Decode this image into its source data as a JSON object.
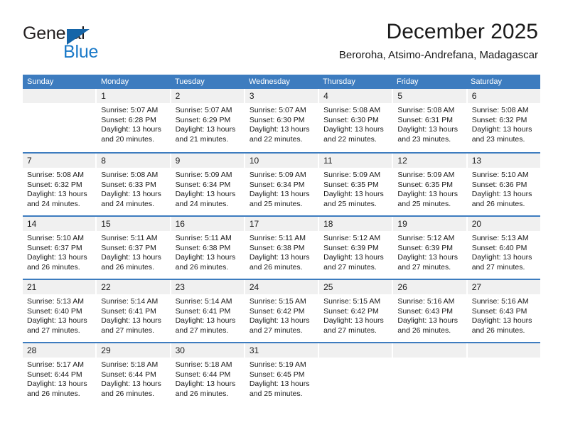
{
  "brand": {
    "word1": "General",
    "word2": "Blue",
    "triangle_color": "#1565a8",
    "blue_color": "#1a79c8"
  },
  "header": {
    "title": "December 2025",
    "subtitle": "Beroroha, Atsimo-Andrefana, Madagascar"
  },
  "theme": {
    "header_row_bg": "#3d7cbf",
    "daynum_bg": "#f0f0f0",
    "text_color": "#1a1a1a"
  },
  "weekdays": [
    "Sunday",
    "Monday",
    "Tuesday",
    "Wednesday",
    "Thursday",
    "Friday",
    "Saturday"
  ],
  "labels": {
    "sunrise_prefix": "Sunrise: ",
    "sunset_prefix": "Sunset: ",
    "daylight_prefix": "Daylight: "
  },
  "weeks": [
    [
      {
        "day": ""
      },
      {
        "day": "1",
        "sunrise": "Sunrise: 5:07 AM",
        "sunset": "Sunset: 6:28 PM",
        "daylight1": "Daylight: 13 hours",
        "daylight2": "and 20 minutes."
      },
      {
        "day": "2",
        "sunrise": "Sunrise: 5:07 AM",
        "sunset": "Sunset: 6:29 PM",
        "daylight1": "Daylight: 13 hours",
        "daylight2": "and 21 minutes."
      },
      {
        "day": "3",
        "sunrise": "Sunrise: 5:07 AM",
        "sunset": "Sunset: 6:30 PM",
        "daylight1": "Daylight: 13 hours",
        "daylight2": "and 22 minutes."
      },
      {
        "day": "4",
        "sunrise": "Sunrise: 5:08 AM",
        "sunset": "Sunset: 6:30 PM",
        "daylight1": "Daylight: 13 hours",
        "daylight2": "and 22 minutes."
      },
      {
        "day": "5",
        "sunrise": "Sunrise: 5:08 AM",
        "sunset": "Sunset: 6:31 PM",
        "daylight1": "Daylight: 13 hours",
        "daylight2": "and 23 minutes."
      },
      {
        "day": "6",
        "sunrise": "Sunrise: 5:08 AM",
        "sunset": "Sunset: 6:32 PM",
        "daylight1": "Daylight: 13 hours",
        "daylight2": "and 23 minutes."
      }
    ],
    [
      {
        "day": "7",
        "sunrise": "Sunrise: 5:08 AM",
        "sunset": "Sunset: 6:32 PM",
        "daylight1": "Daylight: 13 hours",
        "daylight2": "and 24 minutes."
      },
      {
        "day": "8",
        "sunrise": "Sunrise: 5:08 AM",
        "sunset": "Sunset: 6:33 PM",
        "daylight1": "Daylight: 13 hours",
        "daylight2": "and 24 minutes."
      },
      {
        "day": "9",
        "sunrise": "Sunrise: 5:09 AM",
        "sunset": "Sunset: 6:34 PM",
        "daylight1": "Daylight: 13 hours",
        "daylight2": "and 24 minutes."
      },
      {
        "day": "10",
        "sunrise": "Sunrise: 5:09 AM",
        "sunset": "Sunset: 6:34 PM",
        "daylight1": "Daylight: 13 hours",
        "daylight2": "and 25 minutes."
      },
      {
        "day": "11",
        "sunrise": "Sunrise: 5:09 AM",
        "sunset": "Sunset: 6:35 PM",
        "daylight1": "Daylight: 13 hours",
        "daylight2": "and 25 minutes."
      },
      {
        "day": "12",
        "sunrise": "Sunrise: 5:09 AM",
        "sunset": "Sunset: 6:35 PM",
        "daylight1": "Daylight: 13 hours",
        "daylight2": "and 25 minutes."
      },
      {
        "day": "13",
        "sunrise": "Sunrise: 5:10 AM",
        "sunset": "Sunset: 6:36 PM",
        "daylight1": "Daylight: 13 hours",
        "daylight2": "and 26 minutes."
      }
    ],
    [
      {
        "day": "14",
        "sunrise": "Sunrise: 5:10 AM",
        "sunset": "Sunset: 6:37 PM",
        "daylight1": "Daylight: 13 hours",
        "daylight2": "and 26 minutes."
      },
      {
        "day": "15",
        "sunrise": "Sunrise: 5:11 AM",
        "sunset": "Sunset: 6:37 PM",
        "daylight1": "Daylight: 13 hours",
        "daylight2": "and 26 minutes."
      },
      {
        "day": "16",
        "sunrise": "Sunrise: 5:11 AM",
        "sunset": "Sunset: 6:38 PM",
        "daylight1": "Daylight: 13 hours",
        "daylight2": "and 26 minutes."
      },
      {
        "day": "17",
        "sunrise": "Sunrise: 5:11 AM",
        "sunset": "Sunset: 6:38 PM",
        "daylight1": "Daylight: 13 hours",
        "daylight2": "and 26 minutes."
      },
      {
        "day": "18",
        "sunrise": "Sunrise: 5:12 AM",
        "sunset": "Sunset: 6:39 PM",
        "daylight1": "Daylight: 13 hours",
        "daylight2": "and 27 minutes."
      },
      {
        "day": "19",
        "sunrise": "Sunrise: 5:12 AM",
        "sunset": "Sunset: 6:39 PM",
        "daylight1": "Daylight: 13 hours",
        "daylight2": "and 27 minutes."
      },
      {
        "day": "20",
        "sunrise": "Sunrise: 5:13 AM",
        "sunset": "Sunset: 6:40 PM",
        "daylight1": "Daylight: 13 hours",
        "daylight2": "and 27 minutes."
      }
    ],
    [
      {
        "day": "21",
        "sunrise": "Sunrise: 5:13 AM",
        "sunset": "Sunset: 6:40 PM",
        "daylight1": "Daylight: 13 hours",
        "daylight2": "and 27 minutes."
      },
      {
        "day": "22",
        "sunrise": "Sunrise: 5:14 AM",
        "sunset": "Sunset: 6:41 PM",
        "daylight1": "Daylight: 13 hours",
        "daylight2": "and 27 minutes."
      },
      {
        "day": "23",
        "sunrise": "Sunrise: 5:14 AM",
        "sunset": "Sunset: 6:41 PM",
        "daylight1": "Daylight: 13 hours",
        "daylight2": "and 27 minutes."
      },
      {
        "day": "24",
        "sunrise": "Sunrise: 5:15 AM",
        "sunset": "Sunset: 6:42 PM",
        "daylight1": "Daylight: 13 hours",
        "daylight2": "and 27 minutes."
      },
      {
        "day": "25",
        "sunrise": "Sunrise: 5:15 AM",
        "sunset": "Sunset: 6:42 PM",
        "daylight1": "Daylight: 13 hours",
        "daylight2": "and 27 minutes."
      },
      {
        "day": "26",
        "sunrise": "Sunrise: 5:16 AM",
        "sunset": "Sunset: 6:43 PM",
        "daylight1": "Daylight: 13 hours",
        "daylight2": "and 26 minutes."
      },
      {
        "day": "27",
        "sunrise": "Sunrise: 5:16 AM",
        "sunset": "Sunset: 6:43 PM",
        "daylight1": "Daylight: 13 hours",
        "daylight2": "and 26 minutes."
      }
    ],
    [
      {
        "day": "28",
        "sunrise": "Sunrise: 5:17 AM",
        "sunset": "Sunset: 6:44 PM",
        "daylight1": "Daylight: 13 hours",
        "daylight2": "and 26 minutes."
      },
      {
        "day": "29",
        "sunrise": "Sunrise: 5:18 AM",
        "sunset": "Sunset: 6:44 PM",
        "daylight1": "Daylight: 13 hours",
        "daylight2": "and 26 minutes."
      },
      {
        "day": "30",
        "sunrise": "Sunrise: 5:18 AM",
        "sunset": "Sunset: 6:44 PM",
        "daylight1": "Daylight: 13 hours",
        "daylight2": "and 26 minutes."
      },
      {
        "day": "31",
        "sunrise": "Sunrise: 5:19 AM",
        "sunset": "Sunset: 6:45 PM",
        "daylight1": "Daylight: 13 hours",
        "daylight2": "and 25 minutes."
      },
      {
        "day": ""
      },
      {
        "day": ""
      },
      {
        "day": ""
      }
    ]
  ]
}
